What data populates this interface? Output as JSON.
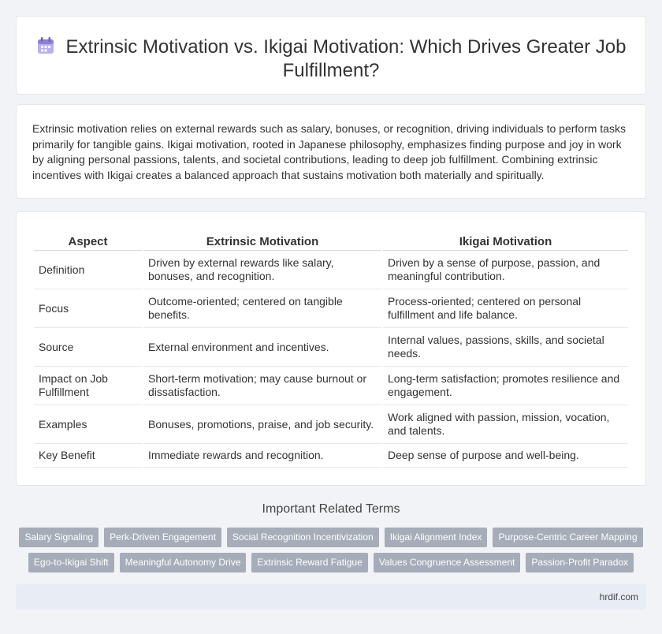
{
  "header": {
    "title": "Extrinsic Motivation vs. Ikigai Motivation: Which Drives Greater Job Fulfillment?",
    "icon": "calendar-icon"
  },
  "intro": {
    "text": "Extrinsic motivation relies on external rewards such as salary, bonuses, or recognition, driving individuals to perform tasks primarily for tangible gains. Ikigai motivation, rooted in Japanese philosophy, emphasizes finding purpose and joy in work by aligning personal passions, talents, and societal contributions, leading to deep job fulfillment. Combining extrinsic incentives with Ikigai creates a balanced approach that sustains motivation both materially and spiritually."
  },
  "table": {
    "headers": [
      "Aspect",
      "Extrinsic Motivation",
      "Ikigai Motivation"
    ],
    "rows": [
      [
        "Definition",
        "Driven by external rewards like salary, bonuses, and recognition.",
        "Driven by a sense of purpose, passion, and meaningful contribution."
      ],
      [
        "Focus",
        "Outcome-oriented; centered on tangible benefits.",
        "Process-oriented; centered on personal fulfillment and life balance."
      ],
      [
        "Source",
        "External environment and incentives.",
        "Internal values, passions, skills, and societal needs."
      ],
      [
        "Impact on Job Fulfillment",
        "Short-term motivation; may cause burnout or dissatisfaction.",
        "Long-term satisfaction; promotes resilience and engagement."
      ],
      [
        "Examples",
        "Bonuses, promotions, praise, and job security.",
        "Work aligned with passion, mission, vocation, and talents."
      ],
      [
        "Key Benefit",
        "Immediate rewards and recognition.",
        "Deep sense of purpose and well-being."
      ]
    ]
  },
  "related": {
    "title": "Important Related Terms",
    "tags": [
      "Salary Signaling",
      "Perk-Driven Engagement",
      "Social Recognition Incentivization",
      "Ikigai Alignment Index",
      "Purpose-Centric Career Mapping",
      "Ego-to-Ikigai Shift",
      "Meaningful Autonomy Drive",
      "Extrinsic Reward Fatigue",
      "Values Congruence Assessment",
      "Passion-Profit Paradox"
    ]
  },
  "footer": {
    "site": "hrdif.com"
  },
  "colors": {
    "background": "#f1f3f7",
    "tag": "#a6adb8",
    "footer": "#e8ecf4",
    "icon": "#8b7fd6"
  }
}
